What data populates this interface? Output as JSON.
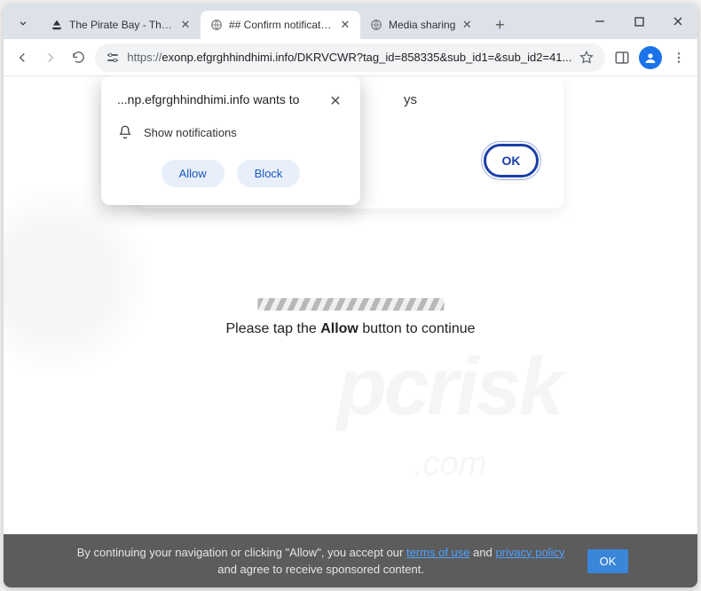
{
  "tabs": [
    {
      "title": "The Pirate Bay - The gal..."
    },
    {
      "title": "## Confirm notifications"
    },
    {
      "title": "Media sharing"
    }
  ],
  "address": {
    "scheme": "https://",
    "rest": "exonp.efgrghhindhimi.info/DKRVCWR?tag_id=858335&sub_id1=&sub_id2=41..."
  },
  "page_dialog": {
    "trailing_text": "ys",
    "ok_label": "OK"
  },
  "perm": {
    "origin": "...np.efgrghhindhimi.info wants to",
    "body": "Show notifications",
    "allow": "Allow",
    "block": "Block"
  },
  "center": {
    "pre": "Please tap the ",
    "bold": "Allow",
    "post": " button to continue"
  },
  "consent": {
    "t1": "By continuing your navigation or clicking \"Allow\", you accept our ",
    "terms": "terms of use",
    "t2": " and ",
    "privacy": "privacy policy",
    "t3": " and agree to receive sponsored content.",
    "ok": "OK"
  },
  "watermark": {
    "big": "pcrisk",
    "small": ".com"
  }
}
